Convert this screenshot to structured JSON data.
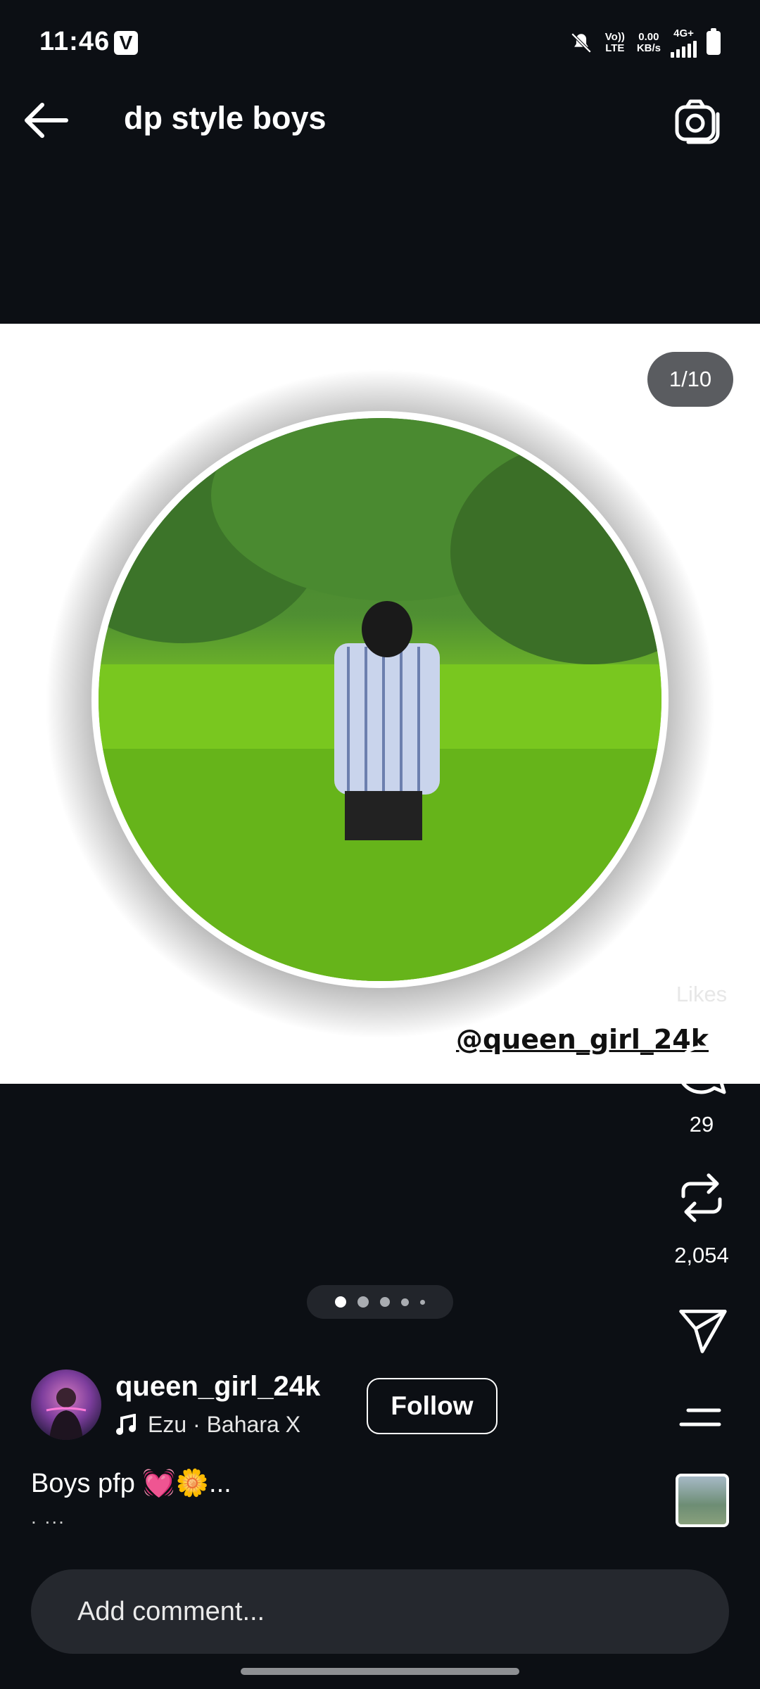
{
  "status_bar": {
    "time": "11:46",
    "app_badge": "V",
    "volte": "Vo)) LTE",
    "speed_value": "0.00",
    "speed_unit": "KB/s",
    "network": "4G+"
  },
  "header": {
    "title": "dp style boys"
  },
  "post": {
    "page_counter": "1/10",
    "watermark": "@queen_girl_24k",
    "carousel_active_index": 0,
    "carousel_dots": 5
  },
  "actions": {
    "likes_label": "Likes",
    "comments_count": "29",
    "reposts_count": "2,054"
  },
  "author": {
    "username": "queen_girl_24k",
    "music": "Ezu · Bahara X",
    "follow_label": "Follow"
  },
  "caption": {
    "text": "Boys pfp 💓🌼...",
    "more": ". ..."
  },
  "comment_box": {
    "placeholder": "Add comment..."
  },
  "colors": {
    "background": "#0c0f14",
    "accent_white": "#ffffff",
    "counter_pill": "#5a5c60"
  }
}
